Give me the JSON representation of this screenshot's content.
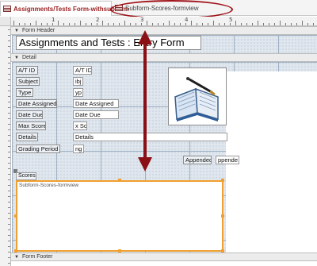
{
  "tabs": [
    {
      "label": "Assignments/Tests Form-withsubform",
      "active": true
    },
    {
      "label": "Subform-Scores-formview",
      "active": false
    }
  ],
  "ruler": {
    "marks": [
      "1",
      "2",
      "3",
      "4",
      "5"
    ]
  },
  "sections": {
    "form_header": "Form Header",
    "detail": "Detail",
    "form_footer": "Form Footer"
  },
  "header_title": "Assignments and Tests : Entry Form",
  "fields": {
    "at_id": {
      "label": "A/T ID",
      "value": "A/T ID"
    },
    "subject": {
      "label": "Subject",
      "value": "ibj"
    },
    "type": {
      "label": "Type",
      "value": "yp"
    },
    "date_assigned": {
      "label": "Date Assigned",
      "value": "Date Assigned"
    },
    "date_due": {
      "label": "Date Due",
      "value": "Date Due"
    },
    "max_score": {
      "label": "Max Score",
      "value": "x Sc"
    },
    "details": {
      "label": "Details",
      "value": "Details"
    },
    "grading_period": {
      "label": "Grading Period",
      "value": "ng F"
    },
    "appended": {
      "label": "Appended",
      "value": "ppende"
    }
  },
  "subform": {
    "label": "Scores",
    "source": "Subform-Scores-formview"
  },
  "colors": {
    "accent": "#a0141a",
    "tab_text": "#9a1d1d",
    "subform_border": "#f0a030",
    "grid": "#dfe6ed"
  }
}
